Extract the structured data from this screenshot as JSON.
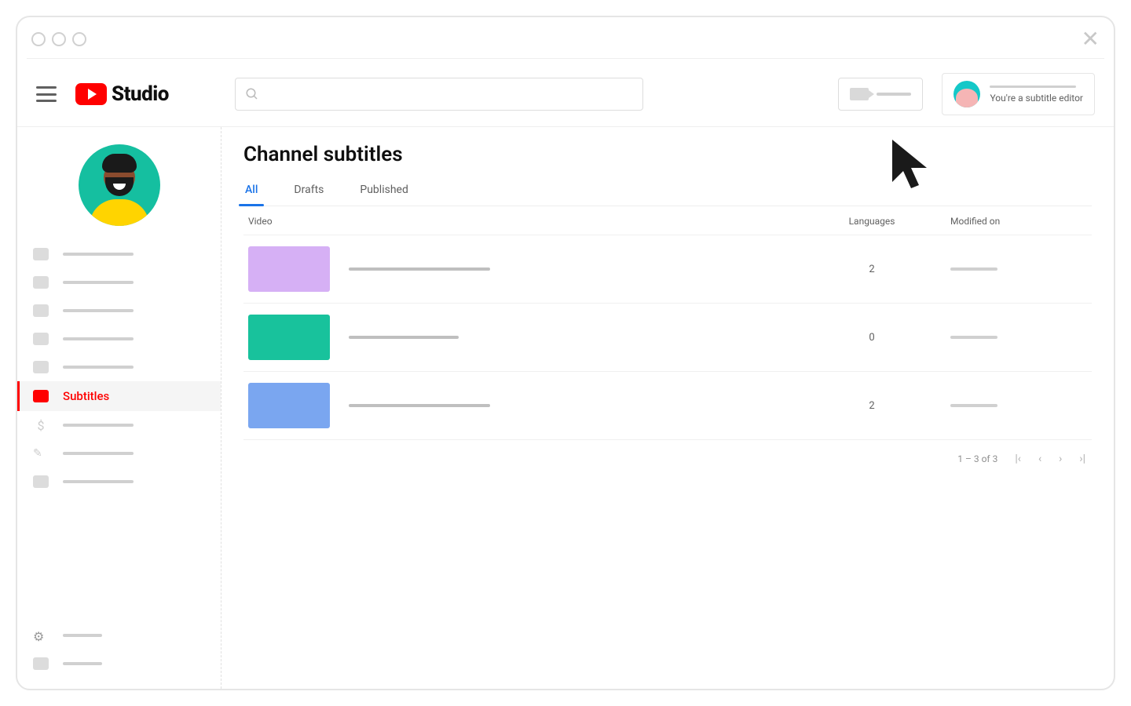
{
  "logo": {
    "text": "Studio"
  },
  "account": {
    "subtitle": "You're a subtitle editor"
  },
  "sidebar": {
    "active_label": "Subtitles"
  },
  "page": {
    "title": "Channel subtitles",
    "tabs": {
      "all": "All",
      "drafts": "Drafts",
      "published": "Published"
    }
  },
  "table": {
    "headers": {
      "video": "Video",
      "languages": "Languages",
      "modified": "Modified on"
    },
    "rows": [
      {
        "languages": "2"
      },
      {
        "languages": "0"
      },
      {
        "languages": "2"
      }
    ]
  },
  "pager": {
    "range": "1 – 3 of 3"
  }
}
